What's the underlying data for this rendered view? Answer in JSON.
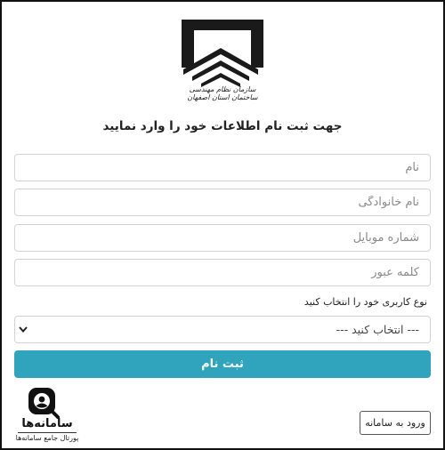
{
  "header": {
    "logo_caption": "سازمان نظام مهندسی ساختمان استان اصفهان",
    "title": "جهت ثبت نام اطلاعات خود را وارد نمایید"
  },
  "form": {
    "first_name": {
      "placeholder": "نام",
      "value": ""
    },
    "last_name": {
      "placeholder": "نام خانوادگی",
      "value": ""
    },
    "mobile": {
      "placeholder": "شماره موبایل",
      "value": ""
    },
    "password": {
      "placeholder": "کلمه عبور",
      "value": ""
    },
    "user_type_label": "نوع کاربری خود را انتخاب کنید",
    "user_type_selected": "--- انتخاب کنید ---",
    "submit_label": "ثبت نام"
  },
  "footer": {
    "login_label": "ورود به سامانه"
  },
  "watermark": {
    "name": "سامانه‌ها",
    "subtitle": "پورتال جامع سامانه‌ها",
    "icon": "user-search-icon"
  },
  "colors": {
    "accent": "#2fa4bc",
    "border": "#d3d3d3"
  }
}
